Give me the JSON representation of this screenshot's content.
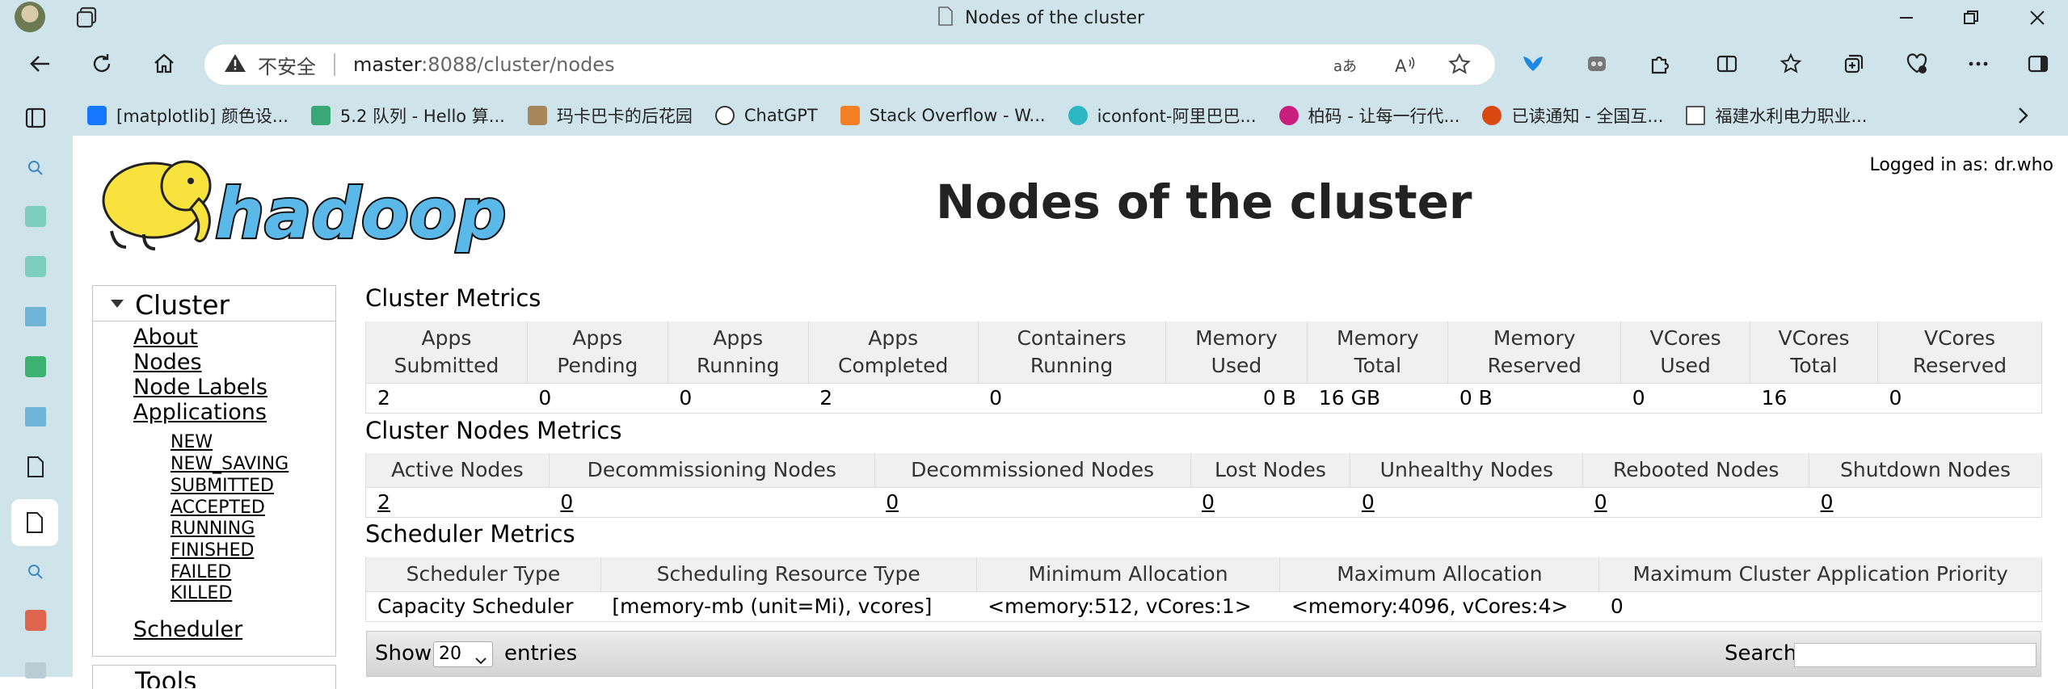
{
  "browser": {
    "tab_title": "Nodes of the cluster",
    "insecure_label": "不安全",
    "url_host": "master",
    "url_rest": ":8088/cluster/nodes",
    "bookmarks": [
      {
        "label": "[matplotlib] 颜色设...",
        "icon_color": "#1677ff"
      },
      {
        "label": "5.2   队列 - Hello 算...",
        "icon_color": "#3aa876"
      },
      {
        "label": "玛卡巴卡的后花园",
        "icon_color": "#a8875a"
      },
      {
        "label": "ChatGPT",
        "icon_color": "#333333"
      },
      {
        "label": "Stack Overflow - W...",
        "icon_color": "#f48024"
      },
      {
        "label": "iconfont-阿里巴巴...",
        "icon_color": "#2db7c4"
      },
      {
        "label": "柏码 - 让每一行代...",
        "icon_color": "#c9207e"
      },
      {
        "label": "已读通知 - 全国互...",
        "icon_color": "#d9480f"
      },
      {
        "label": "福建水利电力职业...",
        "icon_color": "#555555"
      }
    ]
  },
  "page": {
    "title": "Nodes of the cluster",
    "logged_in": "Logged in as: dr.who"
  },
  "nav": {
    "cluster": "Cluster",
    "links": [
      "About",
      "Nodes",
      "Node Labels",
      "Applications"
    ],
    "app_states": [
      "NEW",
      "NEW_SAVING",
      "SUBMITTED",
      "ACCEPTED",
      "RUNNING",
      "FINISHED",
      "FAILED",
      "KILLED"
    ],
    "scheduler": "Scheduler",
    "tools_partial": "Tools"
  },
  "cluster_metrics": {
    "title": "Cluster Metrics",
    "headers": [
      [
        "Apps",
        "Submitted"
      ],
      [
        "Apps",
        "Pending"
      ],
      [
        "Apps",
        "Running"
      ],
      [
        "Apps",
        "Completed"
      ],
      [
        "Containers",
        "Running"
      ],
      [
        "Memory",
        "Used"
      ],
      [
        "Memory",
        "Total"
      ],
      [
        "Memory",
        "Reserved"
      ],
      [
        "VCores",
        "Used"
      ],
      [
        "VCores",
        "Total"
      ],
      [
        "VCores",
        "Reserved"
      ]
    ],
    "values": [
      "2",
      "0",
      "0",
      "2",
      "0",
      "0 B",
      "16 GB",
      "0 B",
      "0",
      "16",
      "0"
    ]
  },
  "nodes_metrics": {
    "title": "Cluster Nodes Metrics",
    "headers": [
      "Active Nodes",
      "Decommissioning Nodes",
      "Decommissioned Nodes",
      "Lost Nodes",
      "Unhealthy Nodes",
      "Rebooted Nodes",
      "Shutdown Nodes"
    ],
    "values": [
      "2",
      "0",
      "0",
      "0",
      "0",
      "0",
      "0"
    ]
  },
  "scheduler_metrics": {
    "title": "Scheduler Metrics",
    "headers": [
      "Scheduler Type",
      "Scheduling Resource Type",
      "Minimum Allocation",
      "Maximum Allocation",
      "Maximum Cluster Application Priority"
    ],
    "values": [
      "Capacity Scheduler",
      "[memory-mb (unit=Mi), vcores]",
      "<memory:512, vCores:1>",
      "<memory:4096, vCores:4>",
      "0"
    ]
  },
  "datatable": {
    "show_label": "Show",
    "entries_value": "20",
    "entries_label": "entries",
    "search_label": "Search:"
  }
}
